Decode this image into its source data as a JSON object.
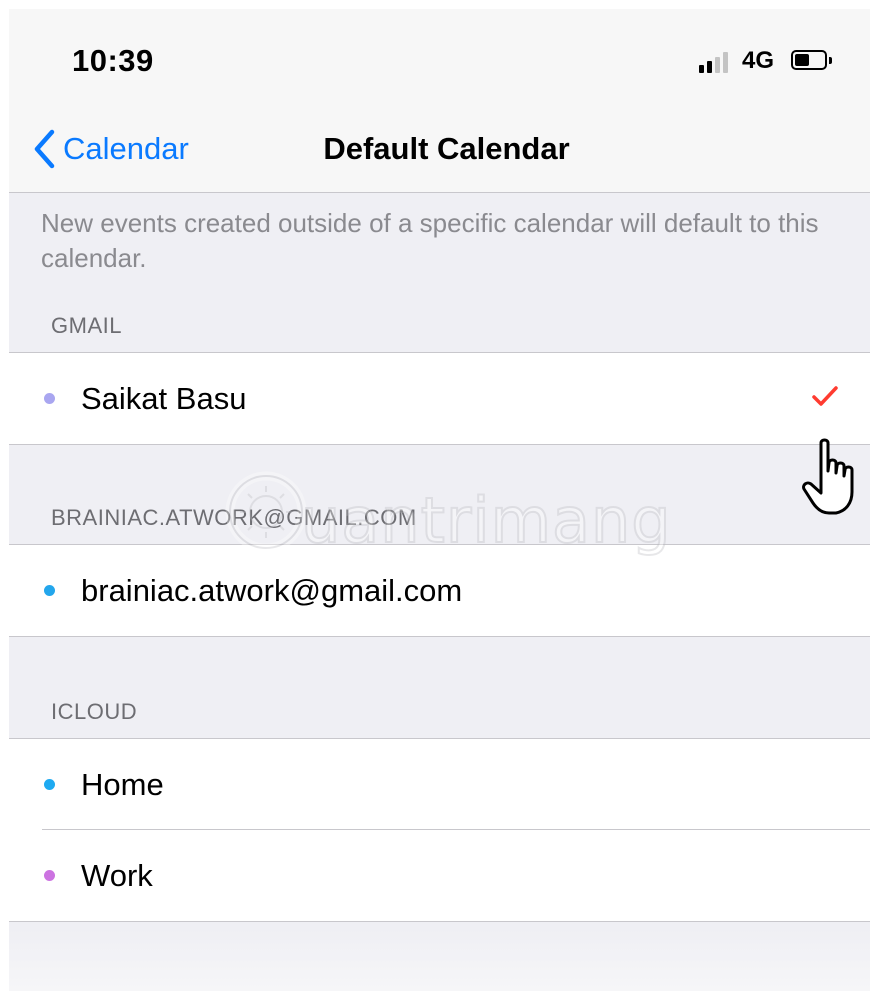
{
  "status_bar": {
    "time": "10:39",
    "network": "4G",
    "signal_bars_filled": 2,
    "signal_bars_total": 4
  },
  "nav": {
    "back_label": "Calendar",
    "title": "Default Calendar"
  },
  "footer_text": "New events created outside of a specific calendar will default to this calendar.",
  "sections": [
    {
      "header": "GMAIL",
      "items": [
        {
          "label": "Saikat Basu",
          "dot_color": "#a9a6f0",
          "selected": true
        }
      ]
    },
    {
      "header": "BRAINIAC.ATWORK@GMAIL.COM",
      "items": [
        {
          "label": "brainiac.atwork@gmail.com",
          "dot_color": "#23a6ec",
          "selected": false
        }
      ]
    },
    {
      "header": "ICLOUD",
      "items": [
        {
          "label": "Home",
          "dot_color": "#1eaaf1",
          "selected": false
        },
        {
          "label": "Work",
          "dot_color": "#cc73e1",
          "selected": false
        }
      ]
    }
  ],
  "colors": {
    "accent": "#0a7aff",
    "checkmark": "#ff3b30",
    "background": "#efeff4"
  },
  "icons": {
    "back": "chevron-left-icon",
    "check": "checkmark-icon",
    "cursor": "hand-pointer-icon"
  }
}
